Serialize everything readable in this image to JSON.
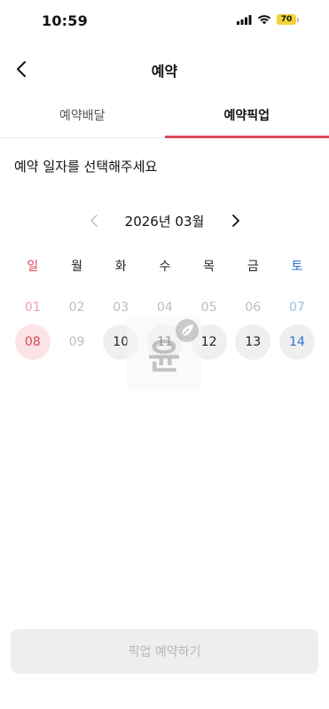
{
  "status_bar": {
    "time": "10:59",
    "battery": "70"
  },
  "nav": {
    "title": "예약"
  },
  "tabs": [
    {
      "label": "예약배달",
      "active": false
    },
    {
      "label": "예약픽업",
      "active": true
    }
  ],
  "prompt": "예약 일자를 선택해주세요",
  "calendar": {
    "month_label": "2026년 03월",
    "weekdays": [
      "일",
      "월",
      "화",
      "수",
      "목",
      "금",
      "토"
    ],
    "weeks": [
      [
        "01",
        "02",
        "03",
        "04",
        "05",
        "06",
        "07"
      ],
      [
        "08",
        "09",
        "10",
        "11",
        "12",
        "13",
        "14"
      ]
    ]
  },
  "watermark": {
    "text": "윤"
  },
  "submit_button": {
    "label": "픽업 예약하기"
  },
  "colors": {
    "accent": "#d94a5a",
    "saturday": "#2f6fd1",
    "battery": "#f2d33a"
  }
}
